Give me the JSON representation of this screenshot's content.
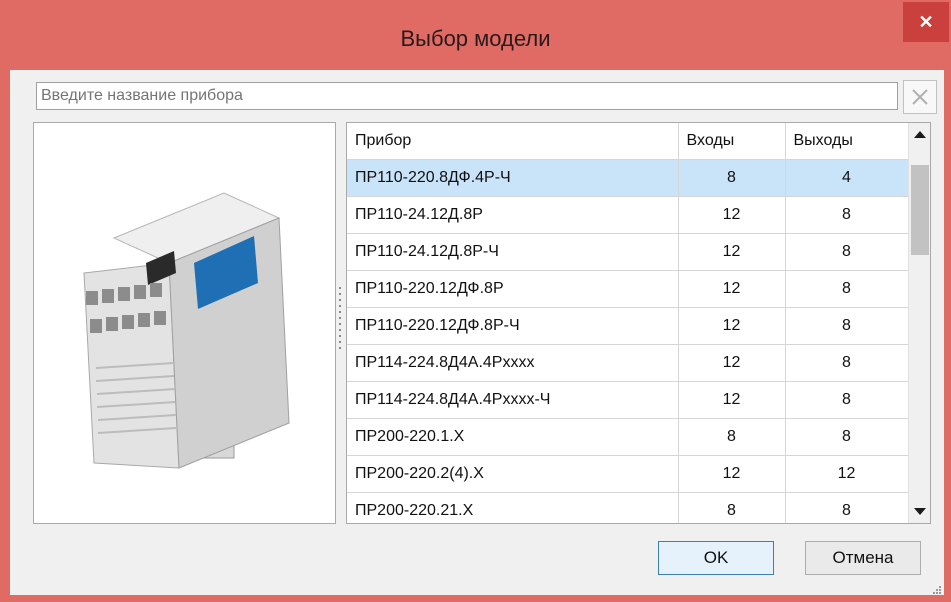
{
  "window": {
    "title": "Выбор модели",
    "close_glyph": "✕"
  },
  "search": {
    "placeholder": "Введите название прибора",
    "value": ""
  },
  "table": {
    "columns": [
      "Прибор",
      "Входы",
      "Выходы"
    ],
    "selected_index": 0,
    "rows": [
      {
        "device": "ПР110-220.8ДФ.4Р-Ч",
        "inputs": "8",
        "outputs": "4"
      },
      {
        "device": "ПР110-24.12Д.8Р",
        "inputs": "12",
        "outputs": "8"
      },
      {
        "device": "ПР110-24.12Д.8Р-Ч",
        "inputs": "12",
        "outputs": "8"
      },
      {
        "device": "ПР110-220.12ДФ.8Р",
        "inputs": "12",
        "outputs": "8"
      },
      {
        "device": "ПР110-220.12ДФ.8Р-Ч",
        "inputs": "12",
        "outputs": "8"
      },
      {
        "device": "ПР114-224.8Д4А.4Рxxxx",
        "inputs": "12",
        "outputs": "8"
      },
      {
        "device": "ПР114-224.8Д4А.4Рxxxx-Ч",
        "inputs": "12",
        "outputs": "8"
      },
      {
        "device": "ПР200-220.1.Х",
        "inputs": "8",
        "outputs": "8"
      },
      {
        "device": "ПР200-220.2(4).Х",
        "inputs": "12",
        "outputs": "12"
      },
      {
        "device": "ПР200-220.21.Х",
        "inputs": "8",
        "outputs": "8"
      }
    ]
  },
  "buttons": {
    "ok": "OK",
    "cancel": "Отмена"
  },
  "colors": {
    "title_bar": "#e06a64",
    "close_button": "#c9403c",
    "selection": "#c9e3f8",
    "device_label": "#1f6fb5"
  },
  "icons": {
    "close": "close-icon",
    "clear": "clear-icon",
    "scroll_up": "chevron-up-icon",
    "scroll_down": "chevron-down-icon"
  }
}
